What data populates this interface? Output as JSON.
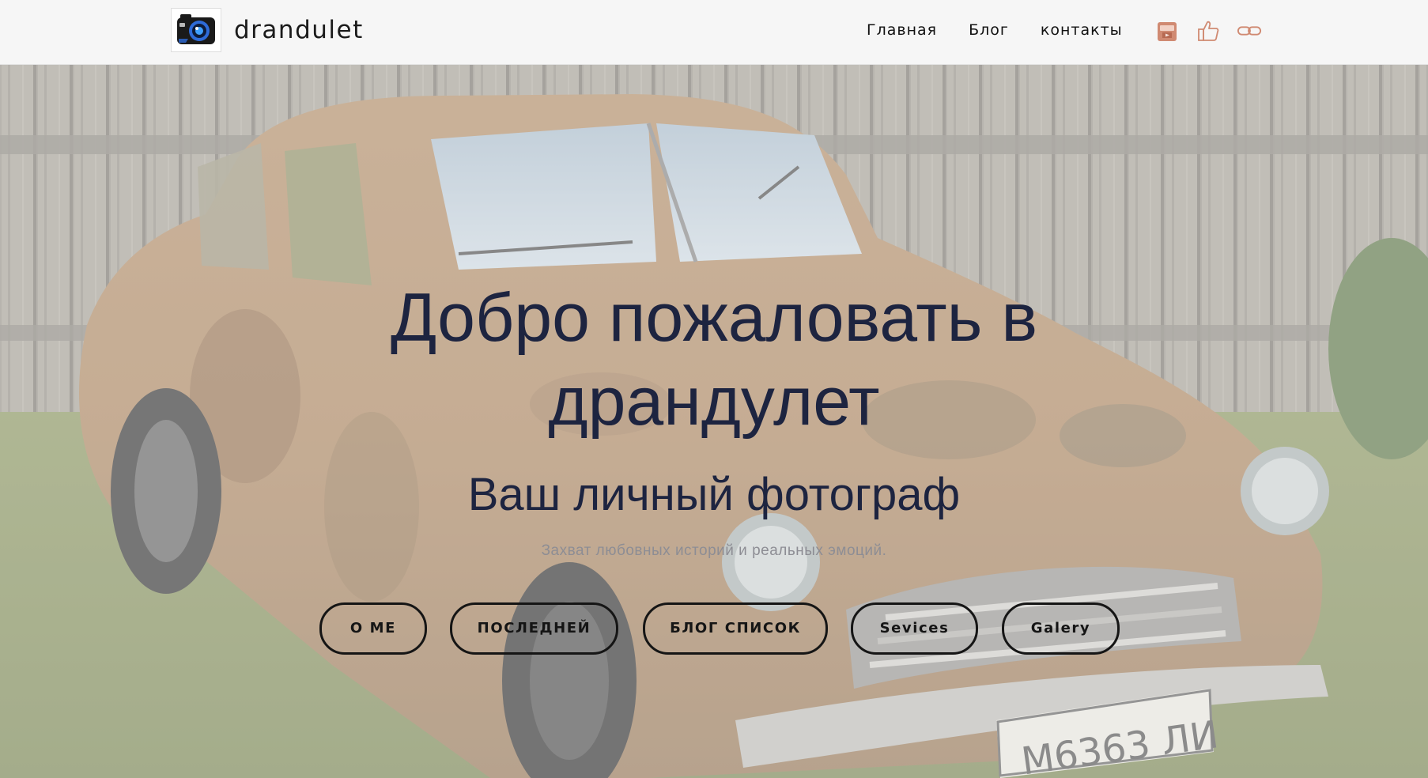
{
  "header": {
    "brand_name": "drandulet",
    "nav": [
      {
        "label": "Главная"
      },
      {
        "label": "Блог"
      },
      {
        "label": "контакты"
      }
    ],
    "social_icons": [
      "youtube-icon",
      "thumbs-up-icon",
      "link-icon"
    ],
    "accent_color": "#d08a72"
  },
  "hero": {
    "title": "Добро пожаловать в драндулет",
    "subtitle": "Ваш личный фотограф",
    "tagline": "Захват любовных историй и реальных эмоций.",
    "buttons": [
      {
        "label": "О МЕ"
      },
      {
        "label": "ПОСЛЕДНЕЙ"
      },
      {
        "label": "БЛОГ СПИСОК"
      },
      {
        "label": "Sevices"
      },
      {
        "label": "Galery"
      }
    ],
    "text_color": "#1d2440"
  }
}
